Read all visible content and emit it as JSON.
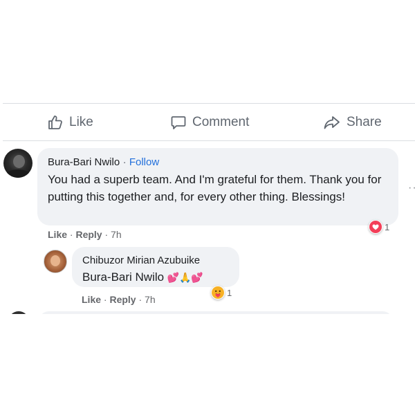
{
  "actions": {
    "like": "Like",
    "comment": "Comment",
    "share": "Share"
  },
  "comments": [
    {
      "author": "Bura-Bari Nwilo",
      "follow": "Follow",
      "text": "You had a superb team. And I'm grateful for them. Thank you for putting this together and, for every other thing. Blessings!",
      "like": "Like",
      "reply": "Reply",
      "time": "7h",
      "reaction_icon": "heart-icon",
      "reaction_count": "1"
    }
  ],
  "replies": [
    {
      "author": "Chibuzor Mirian Azubuike",
      "mention": "Bura-Bari Nwilo",
      "emojis": "💕🙏💕",
      "like": "Like",
      "reply": "Reply",
      "time": "7h",
      "reaction_icon": "care-icon",
      "reaction_count": "1"
    }
  ],
  "colors": {
    "link": "#216fdb",
    "bubble": "#f0f2f5",
    "heart": "#f33e58",
    "care": "#f7b125"
  }
}
